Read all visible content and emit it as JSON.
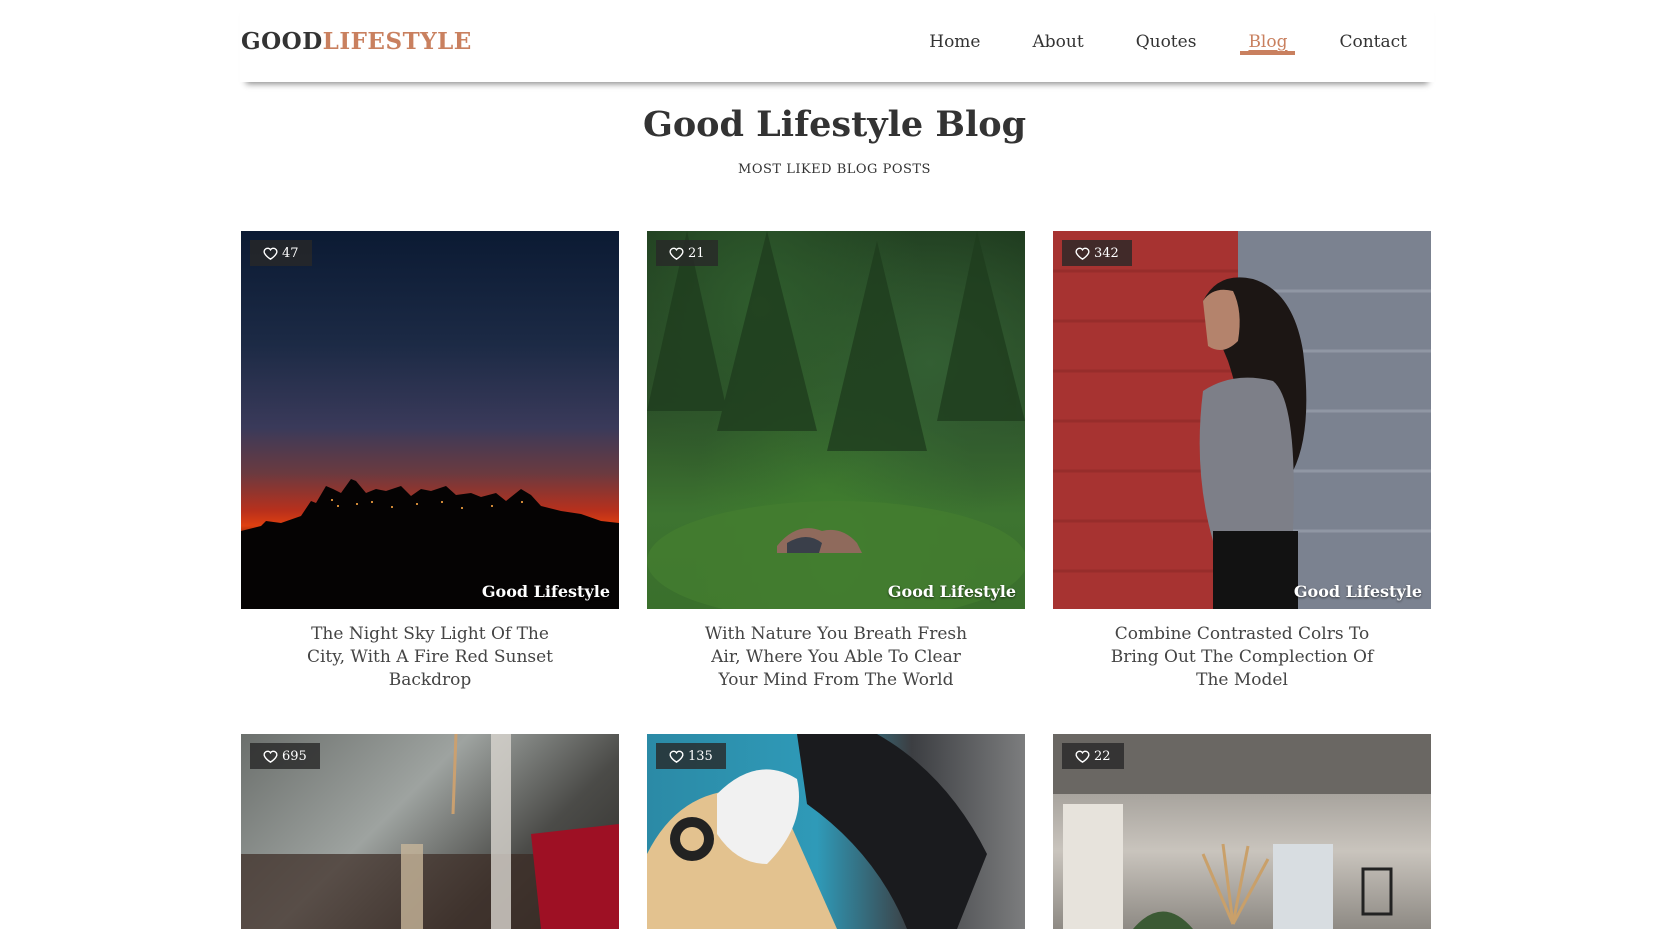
{
  "header": {
    "logo_part1": "GOOD",
    "logo_part2": "LIFESTYLE",
    "nav": [
      "Home",
      "About",
      "Quotes",
      "Blog",
      "Contact"
    ],
    "active": "Blog"
  },
  "hero": {
    "title": "Good Lifestyle Blog",
    "subtitle": "MOST LIKED BLOG POSTS"
  },
  "posts": [
    {
      "likes": "47",
      "brand": "Good Lifestyle",
      "caption": "The Night Sky Light Of The City, With A Fire Red Sunset Backdrop"
    },
    {
      "likes": "21",
      "brand": "Good Lifestyle",
      "caption": "With Nature You Breath Fresh Air, Where You Able To Clear Your Mind From The World"
    },
    {
      "likes": "342",
      "brand": "Good Lifestyle",
      "caption": "Combine Contrasted Colrs To Bring Out The Complection Of The Model"
    },
    {
      "likes": "695"
    },
    {
      "likes": "135"
    },
    {
      "likes": "22"
    }
  ],
  "colors": {
    "accent": "#c9805f",
    "text": "#333333"
  }
}
